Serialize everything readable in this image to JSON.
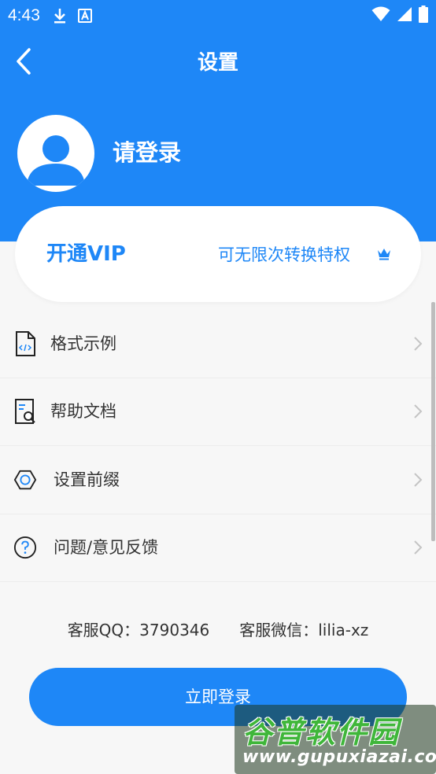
{
  "status_bar": {
    "time": "4:43",
    "icons": [
      "download-icon",
      "text-a-icon",
      "wifi-icon",
      "signal-icon",
      "battery-icon"
    ]
  },
  "header": {
    "title": "设置",
    "back_icon": "chevron-left-icon"
  },
  "profile": {
    "login_prompt": "请登录",
    "avatar_icon": "default-avatar-icon"
  },
  "vip": {
    "title": "开通VIP",
    "description": "可无限次转换特权",
    "icon": "crown-icon"
  },
  "menu": {
    "items": [
      {
        "label": "格式示例",
        "icon": "code-file-icon"
      },
      {
        "label": "帮助文档",
        "icon": "document-search-icon"
      },
      {
        "label": "设置前缀",
        "icon": "hexagon-icon"
      },
      {
        "label": "问题/意见反馈",
        "icon": "question-circle-icon"
      }
    ]
  },
  "contact": {
    "qq": "客服QQ：3790346",
    "wechat": "客服微信：lilia-xz"
  },
  "login_button": {
    "label": "立即登录"
  },
  "watermark": {
    "brand": "谷普软件园",
    "url": "www.gupuxiazai.com"
  },
  "colors": {
    "primary": "#1e87f7",
    "background": "#f7f7f7",
    "text": "#333333"
  }
}
